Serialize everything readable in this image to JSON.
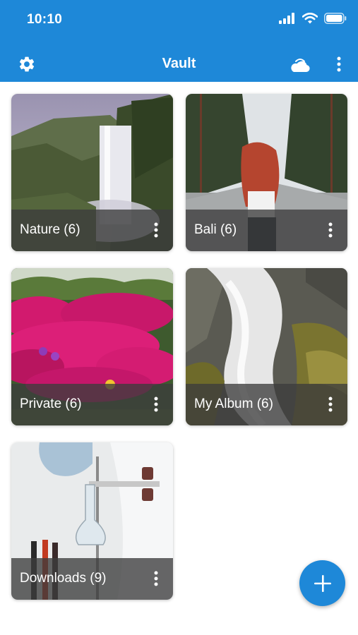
{
  "status_bar": {
    "time": "10:10"
  },
  "app_bar": {
    "title": "Vault",
    "settings_icon": "gear-icon",
    "cloud_icon": "cloud-sync-icon",
    "menu_icon": "more-vert-icon"
  },
  "albums": [
    {
      "label": "Nature (6)",
      "thumbnail": "waterfall-landscape"
    },
    {
      "label": "Bali (6)",
      "thumbnail": "red-haired-woman-on-road"
    },
    {
      "label": "Private (6)",
      "thumbnail": "pink-flowers"
    },
    {
      "label": "My Album (6)",
      "thumbnail": "rocky-waterfall"
    },
    {
      "label": "Downloads (9)",
      "thumbnail": "lab-flask"
    }
  ],
  "fab": {
    "icon": "plus-icon"
  },
  "colors": {
    "primary": "#1e88d8",
    "caption_bg": "#3c3c3c"
  }
}
